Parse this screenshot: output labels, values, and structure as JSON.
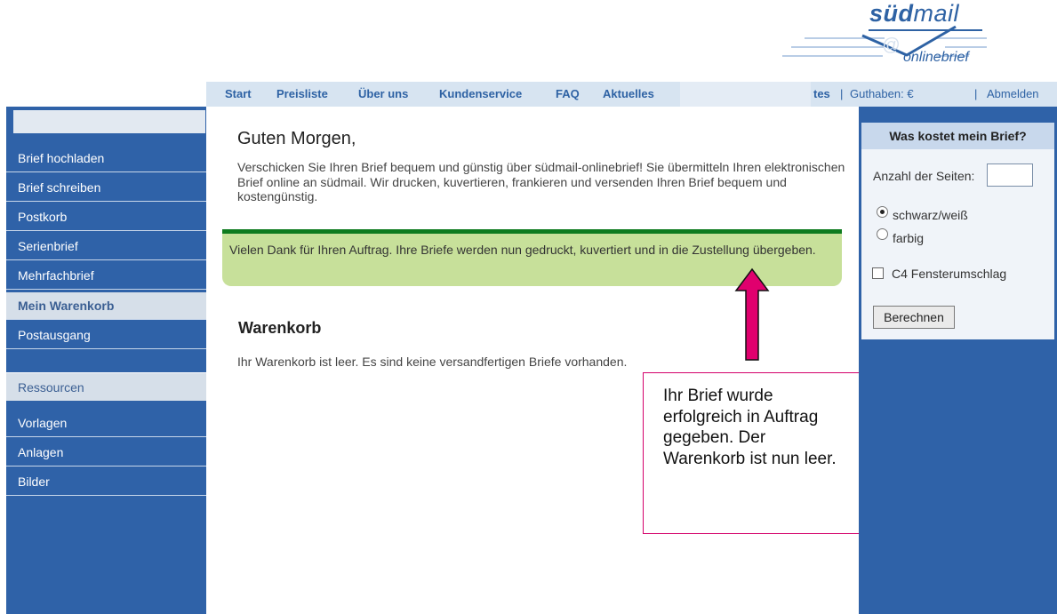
{
  "logo": {
    "brand_bold": "süd",
    "brand_light": "mail",
    "sub": "onlinebrief"
  },
  "nav": {
    "items": [
      "Start",
      "Preisliste",
      "Über uns",
      "Kundenservice",
      "FAQ",
      "Aktuelles"
    ],
    "partial_item": "tes",
    "separator": "|",
    "balance_label": "Guthaben: €",
    "logout": "Abmelden"
  },
  "sidebar": {
    "items": [
      {
        "label": "Brief hochladen"
      },
      {
        "label": "Brief schreiben"
      },
      {
        "label": "Postkorb"
      },
      {
        "label": "Serienbrief"
      },
      {
        "label": "Mehrfachbrief"
      },
      {
        "label": "Mein Warenkorb",
        "active": true
      },
      {
        "label": "Postausgang"
      }
    ],
    "resources_heading": "Ressourcen",
    "resources": [
      {
        "label": "Vorlagen"
      },
      {
        "label": "Anlagen"
      },
      {
        "label": "Bilder"
      }
    ]
  },
  "main": {
    "greeting": "Guten Morgen,",
    "intro": "Verschicken Sie Ihren Brief bequem und günstig über südmail-onlinebrief! Sie übermitteln Ihren elektronischen Brief online an südmail. Wir drucken, kuvertieren, frankieren und versenden Ihren Brief bequem und kostengünstig.",
    "success_message": "Vielen Dank für Ihren Auftrag. Ihre Briefe werden nun gedruckt, kuvertiert und in die Zustellung übergeben.",
    "cart_title": "Warenkorb",
    "cart_empty": "Ihr Warenkorb ist leer. Es sind keine versandfertigen Briefe vorhanden."
  },
  "callout": {
    "text": "Ihr Brief wurde erfolgreich in Auftrag gegeben. Der Warenkorb ist nun leer.",
    "border_color": "#d4006a"
  },
  "calculator": {
    "title": "Was kostet mein Brief?",
    "pages_label": "Anzahl der Seiten:",
    "pages_value": "",
    "options": [
      {
        "label": "schwarz/weiß",
        "selected": true
      },
      {
        "label": "farbig",
        "selected": false
      }
    ],
    "envelope_label": "C4 Fensterumschlag",
    "envelope_checked": false,
    "button": "Berechnen"
  },
  "colors": {
    "sidebar_blue": "#2f62a8",
    "nav_bg": "#d7e4f1",
    "success_bg": "#c7e09a",
    "success_border": "#0e7b1f",
    "arrow": "#e0006e"
  }
}
